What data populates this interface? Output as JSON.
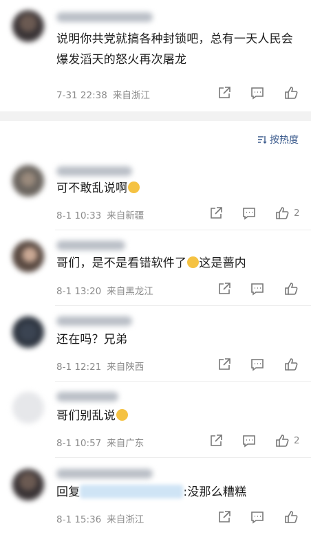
{
  "sort_label": "按热度",
  "comments": [
    {
      "text": "说明你共党就搞各种封锁吧，总有一天人民会爆发滔天的怒火再次屠龙",
      "date": "7-31 22:38",
      "location": "来自浙江",
      "likes": ""
    },
    {
      "text": "可不敢乱说啊",
      "date": "8-1 10:33",
      "location": "来自新疆",
      "likes": "2"
    },
    {
      "text_a": "哥们，是不是看错软件了",
      "text_b": "这是蔷内",
      "date": "8-1 13:20",
      "location": "来自黑龙江",
      "likes": ""
    },
    {
      "text": "还在吗？兄弟",
      "date": "8-1 12:21",
      "location": "来自陕西",
      "likes": ""
    },
    {
      "text": "哥们别乱说",
      "date": "8-1 10:57",
      "location": "来自广东",
      "likes": "2"
    },
    {
      "text_a": "回复",
      "text_b": ":没那么糟糕",
      "date": "8-1 15:36",
      "location": "来自浙江",
      "likes": ""
    }
  ]
}
